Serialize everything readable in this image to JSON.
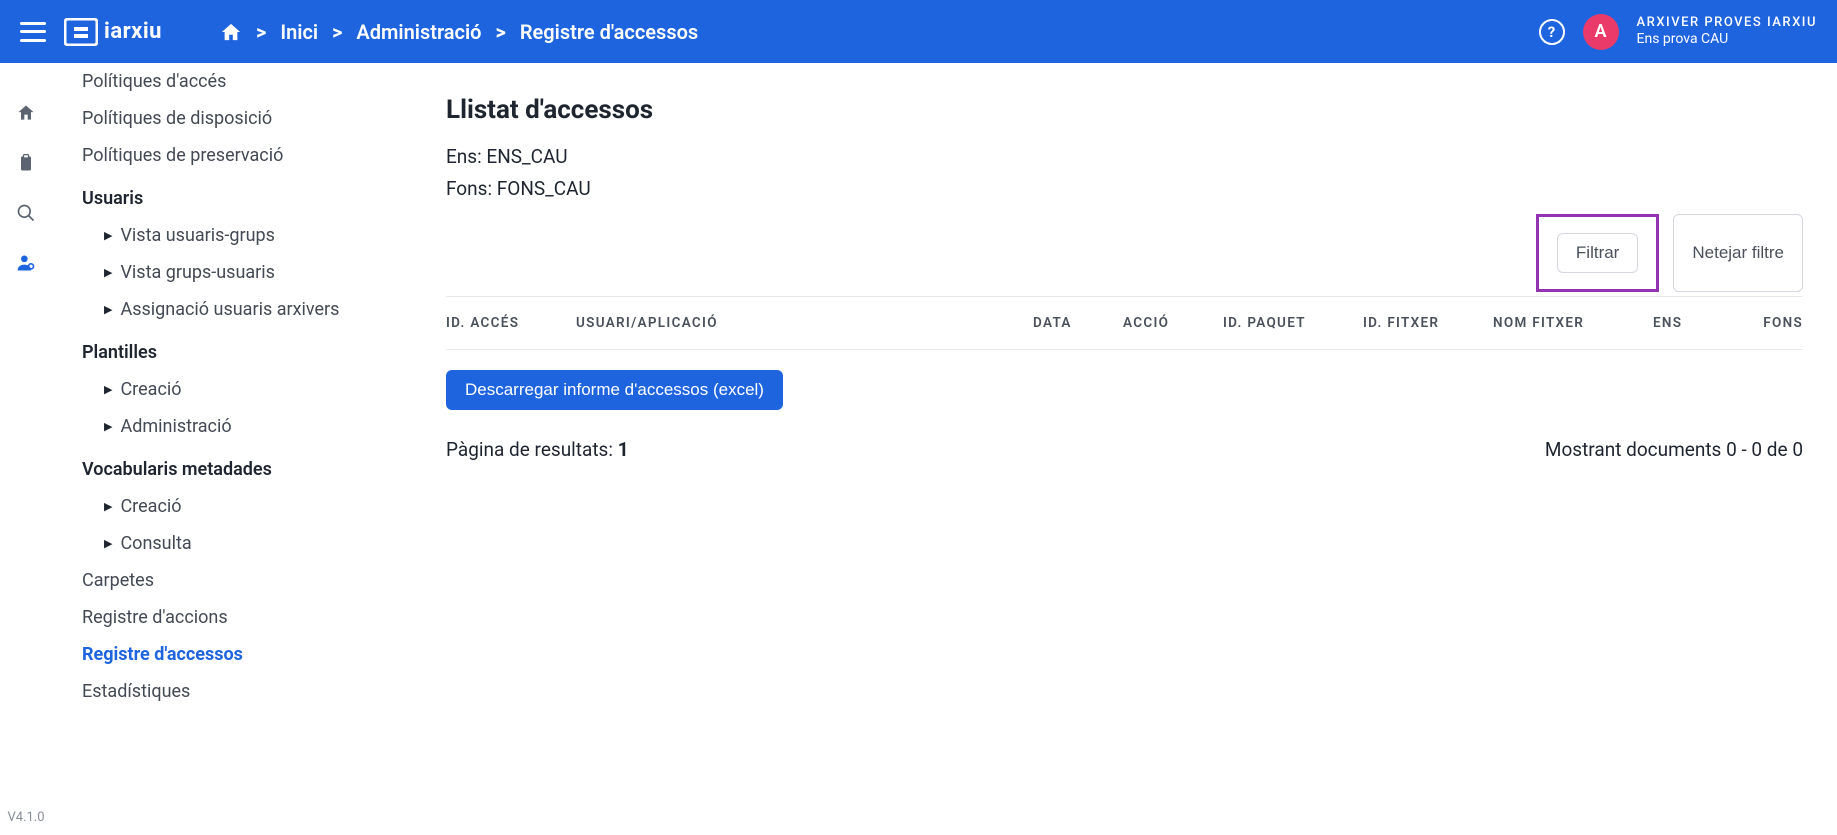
{
  "brand": {
    "name": "iarxiu"
  },
  "breadcrumb": {
    "home_aria": "Inici",
    "items": [
      "Inici",
      "Administració",
      "Registre d'accessos"
    ]
  },
  "user": {
    "initial": "A",
    "name": "ARXIVER PROVES IARXIU",
    "entity": "Ens prova CAU"
  },
  "version": "V4.1.0",
  "sidebar": {
    "items": [
      {
        "label": "Polítiques d'accés",
        "type": "item"
      },
      {
        "label": "Polítiques de disposició",
        "type": "item"
      },
      {
        "label": "Polítiques de preservació",
        "type": "item"
      },
      {
        "label": "Usuaris",
        "type": "heading"
      },
      {
        "label": "Vista usuaris-grups",
        "type": "sub"
      },
      {
        "label": "Vista grups-usuaris",
        "type": "sub"
      },
      {
        "label": "Assignació usuaris arxivers",
        "type": "sub"
      },
      {
        "label": "Plantilles",
        "type": "heading"
      },
      {
        "label": "Creació",
        "type": "sub"
      },
      {
        "label": "Administració",
        "type": "sub"
      },
      {
        "label": "Vocabularis metadades",
        "type": "heading"
      },
      {
        "label": "Creació",
        "type": "sub"
      },
      {
        "label": "Consulta",
        "type": "sub"
      },
      {
        "label": "Carpetes",
        "type": "item"
      },
      {
        "label": "Registre d'accions",
        "type": "item"
      },
      {
        "label": "Registre d'accessos",
        "type": "item",
        "active": true
      },
      {
        "label": "Estadístiques",
        "type": "item"
      }
    ]
  },
  "main": {
    "title": "Llistat d'accessos",
    "ens_label": "Ens:",
    "ens_value": "ENS_CAU",
    "fons_label": "Fons:",
    "fons_value": "FONS_CAU",
    "filter_btn": "Filtrar",
    "clear_btn": "Netejar filtre",
    "download_btn": "Descarregar informe d'accessos (excel)",
    "columns": {
      "id_acces": "ID. ACCÉS",
      "usuari": "USUARI/APLICACIÓ",
      "data": "DATA",
      "accio": "ACCIÓ",
      "id_paquet": "ID. PAQUET",
      "id_fitxer": "ID. FITXER",
      "nom_fitxer": "NOM FITXER",
      "ens": "ENS",
      "fons": "FONS"
    },
    "results": {
      "page_label": "Pàgina de resultats:",
      "page_num": "1",
      "showing": "Mostrant documents 0 - 0 de 0"
    }
  }
}
